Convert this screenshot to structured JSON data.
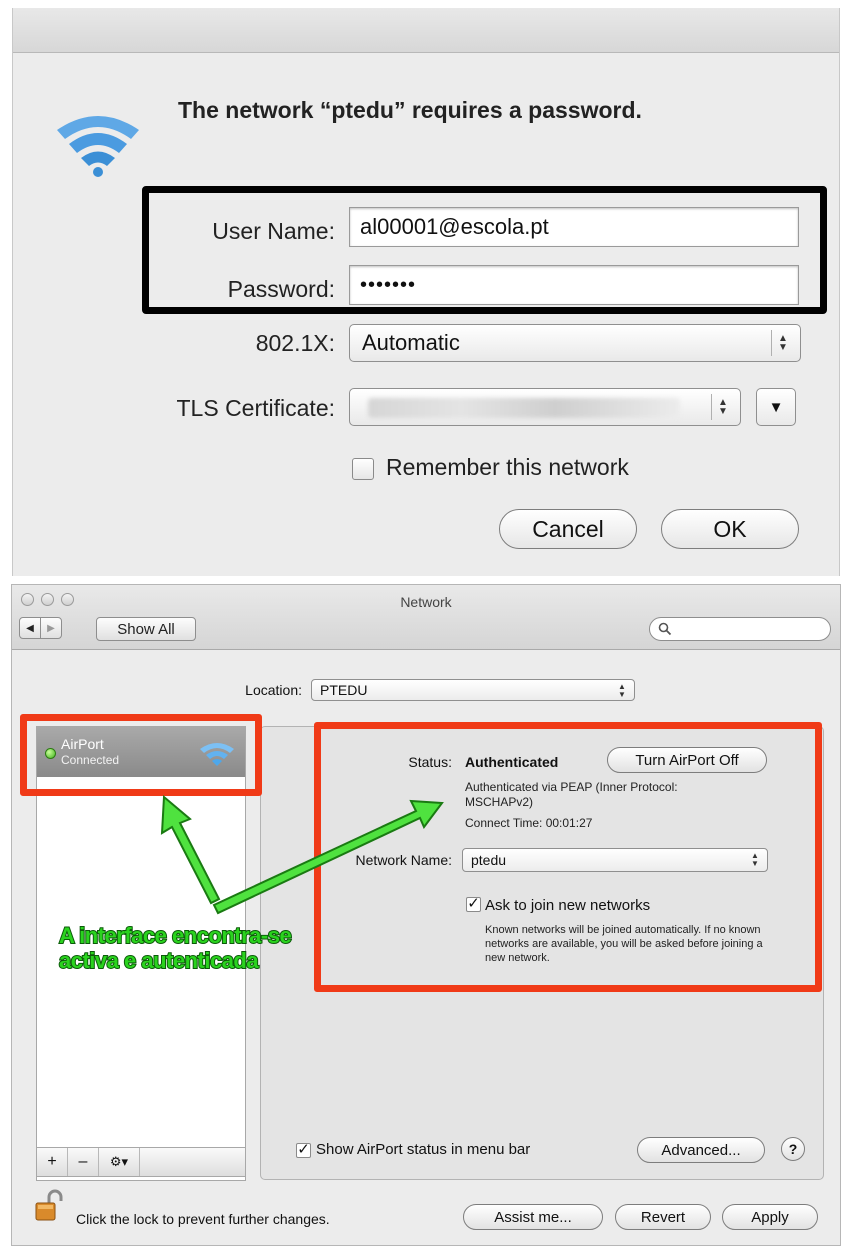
{
  "dialog": {
    "heading": "The network “ptedu” requires a password.",
    "username_label": "User Name:",
    "username_value": "al00001@escola.pt",
    "password_label": "Password:",
    "password_value": "•••••••",
    "auth_label": "802.1X:",
    "auth_value": "Automatic",
    "tls_label": "TLS Certificate:",
    "remember_label": "Remember this network",
    "cancel_label": "Cancel",
    "ok_label": "OK"
  },
  "window": {
    "title": "Network",
    "show_all_label": "Show All",
    "location_label": "Location:",
    "location_value": "PTEDU",
    "sidebar": {
      "items": [
        {
          "name": "AirPort",
          "status": "Connected"
        }
      ]
    },
    "status_label": "Status:",
    "status_value": "Authenticated",
    "turn_off_label": "Turn AirPort Off",
    "status_detail": "Authenticated via PEAP (Inner Protocol: MSCHAPv2)",
    "connect_time": "Connect Time: 00:01:27",
    "network_name_label": "Network Name:",
    "network_name_value": "ptedu",
    "ask_join_label": "Ask to join new networks",
    "ask_join_note": "Known networks will be joined automatically. If no known networks are available, you will be asked before joining a new network.",
    "show_status_label": "Show AirPort status in menu bar",
    "advanced_label": "Advanced...",
    "help_label": "?",
    "lock_text": "Click the lock to prevent further changes.",
    "assist_label": "Assist me...",
    "revert_label": "Revert",
    "apply_label": "Apply",
    "add_label": "+",
    "remove_label": "–",
    "gear_label": "⚙▾"
  },
  "annotation": {
    "line1": "A interface encontra-se",
    "line2": "activa e autenticada"
  },
  "colors": {
    "highlight_red": "#f03a17",
    "annotation_green": "#2ad31e",
    "wifi_blue": "#3b8fd6"
  }
}
